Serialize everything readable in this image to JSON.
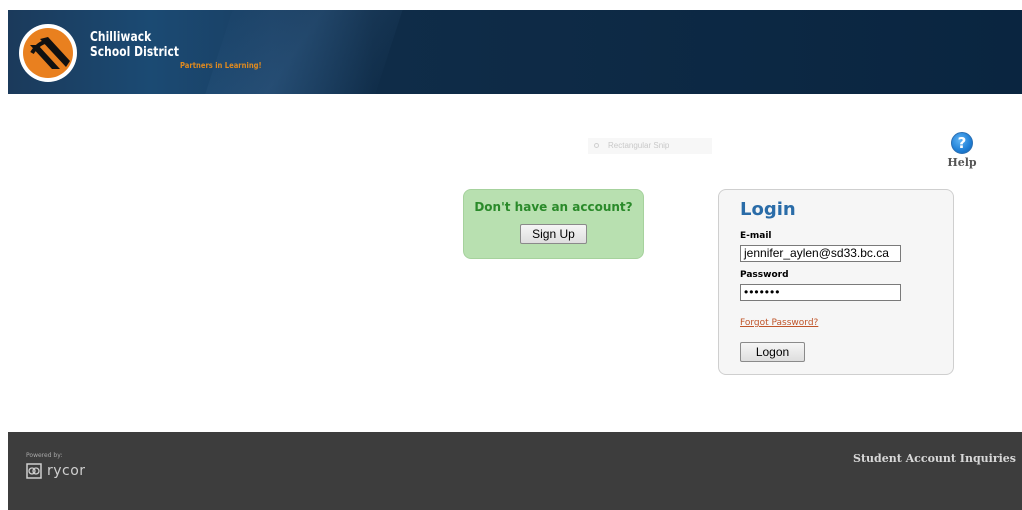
{
  "header": {
    "district_line1": "Chilliwack",
    "district_line2": "School District",
    "tagline": "Partners in Learning!",
    "logo_icon": "chilliwack-sd-logo"
  },
  "snip_overlay": {
    "label": "Rectangular Snip"
  },
  "help": {
    "label": "Help",
    "icon": "question-mark-circle-icon"
  },
  "signup": {
    "prompt": "Don't have an account?",
    "button_label": "Sign Up"
  },
  "login": {
    "title": "Login",
    "email_label": "E-mail",
    "email_value": "jennifer_aylen@sd33.bc.ca",
    "password_label": "Password",
    "password_value": "•••••••",
    "forgot_link": "Forgot Password?",
    "logon_button": "Logon"
  },
  "footer": {
    "powered_by": "Powered by:",
    "vendor": "rycor",
    "inquiries_link": "Student Account Inquiries"
  },
  "colors": {
    "header_bg": "#0a2540",
    "tagline": "#e08a1e",
    "signup_bg": "#b8e0b0",
    "signup_text": "#2a8a2a",
    "login_title": "#2a6ca8",
    "link": "#c0552a",
    "footer_bg": "#3d3d3d"
  }
}
